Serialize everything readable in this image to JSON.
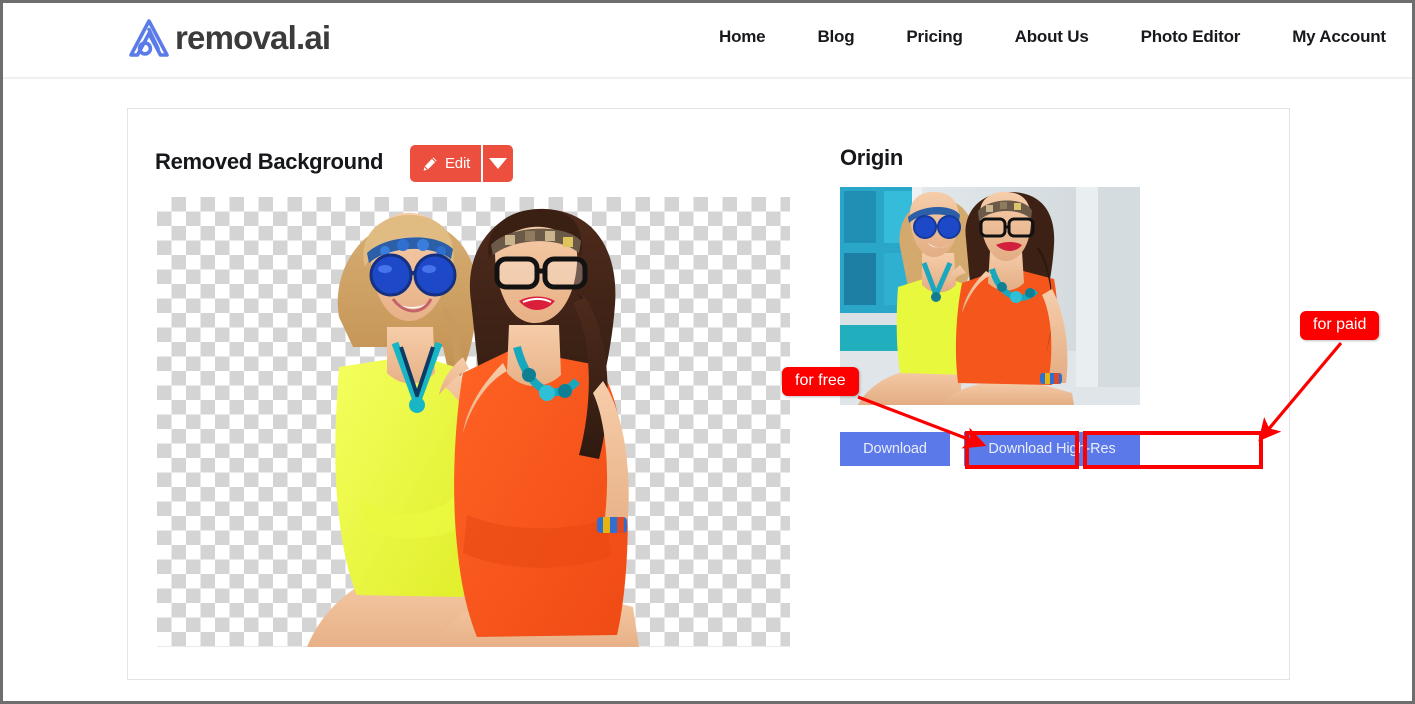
{
  "header": {
    "brand": {
      "text": "removal.ai",
      "mark": "removal-ai-logo-icon",
      "mark_color": "#5b7ce8"
    },
    "nav": [
      {
        "label": "Home"
      },
      {
        "label": "Blog"
      },
      {
        "label": "Pricing"
      },
      {
        "label": "About Us"
      },
      {
        "label": "Photo Editor"
      },
      {
        "label": "My Account"
      }
    ]
  },
  "card": {
    "left_panel": {
      "heading": "Removed Background",
      "edit_button": {
        "label": "Edit",
        "icon": "pencil-icon",
        "caret": "caret-down-icon",
        "color": "#ec4f3d"
      },
      "preview": {
        "alt": "two women cutout on transparent checkerboard",
        "transparency_checker": true
      }
    },
    "right_panel": {
      "heading": "Origin",
      "thumbnail": {
        "alt": "two women seated in front of a blue glass building"
      },
      "buttons": [
        {
          "label": "Download",
          "color": "#5b79e8"
        },
        {
          "label": "Download High-Res",
          "color": "#5b79e8"
        }
      ]
    }
  },
  "annotations": {
    "color": "#fc0000",
    "callouts": [
      {
        "label": "for free",
        "points_to": "Download"
      },
      {
        "label": "for paid",
        "points_to": "Download High-Res"
      }
    ]
  }
}
